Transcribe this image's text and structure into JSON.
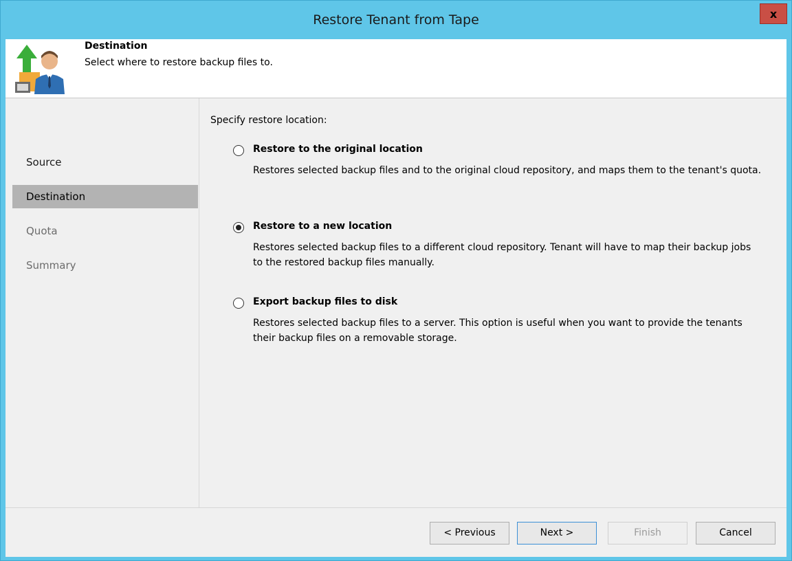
{
  "window": {
    "title": "Restore Tenant from Tape",
    "close_label": "x"
  },
  "header": {
    "title": "Destination",
    "subtitle": "Select where to restore backup files to.",
    "icon": "restore-tenant-icon"
  },
  "sidebar": {
    "items": [
      {
        "label": "Source",
        "state": "enabled"
      },
      {
        "label": "Destination",
        "state": "selected"
      },
      {
        "label": "Quota",
        "state": "disabled"
      },
      {
        "label": "Summary",
        "state": "disabled"
      }
    ]
  },
  "main": {
    "prompt": "Specify restore location:",
    "options": [
      {
        "title": "Restore to the original location",
        "description": "Restores selected backup files and to the original cloud repository, and maps them to the tenant's quota.",
        "checked": false
      },
      {
        "title": "Restore to a new location",
        "description": "Restores selected backup files to a different cloud repository. Tenant will have to map their backup jobs to the restored backup files manually.",
        "checked": true
      },
      {
        "title": "Export backup files to disk",
        "description": "Restores selected backup files to a server. This option is useful when you want to provide the tenants their backup files on a removable storage.",
        "checked": false
      }
    ]
  },
  "footer": {
    "previous_label": "< Previous",
    "next_label": "Next >",
    "finish_label": "Finish",
    "cancel_label": "Cancel"
  },
  "colors": {
    "titlebar": "#5fc6e8",
    "close_button": "#c94f45",
    "sidebar_selected": "#b3b3b3"
  }
}
